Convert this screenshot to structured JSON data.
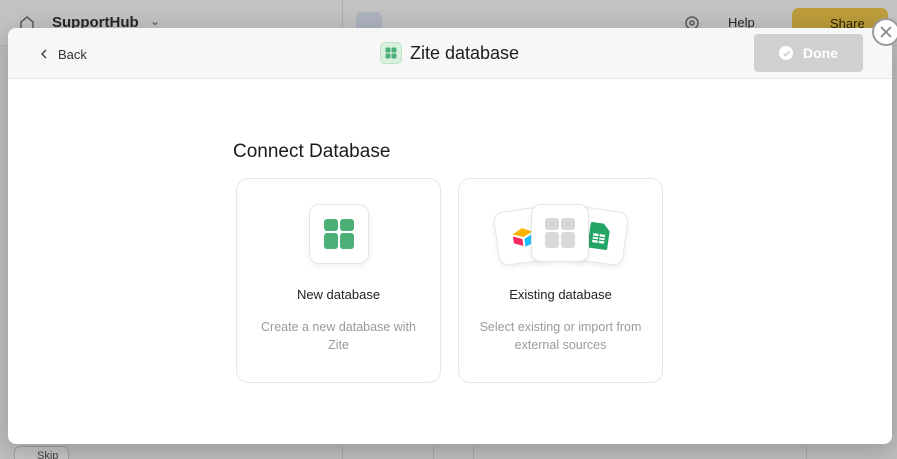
{
  "background": {
    "app_name": "SupportHub",
    "help_label": "Help",
    "share_label": "Share",
    "skip_label": "Skip"
  },
  "modal": {
    "back_label": "Back",
    "title": "Zite database",
    "done_label": "Done",
    "section_title": "Connect Database",
    "options": [
      {
        "title": "New database",
        "description": "Create a new database with Zite"
      },
      {
        "title": "Existing database",
        "description": "Select existing or import from external sources"
      }
    ]
  },
  "colors": {
    "accent_green": "#4caf78",
    "share_yellow": "#f2c94c",
    "done_disabled": "#d0d0d0"
  },
  "icons": [
    "home-icon",
    "chevron-down-icon",
    "grid-view-icon",
    "workflow-icon",
    "database-icon",
    "gear-icon",
    "chat-icon",
    "bolt-icon",
    "chevron-left-icon",
    "table-icon",
    "check-circle-icon",
    "close-icon",
    "airtable-icon",
    "google-sheets-icon"
  ]
}
